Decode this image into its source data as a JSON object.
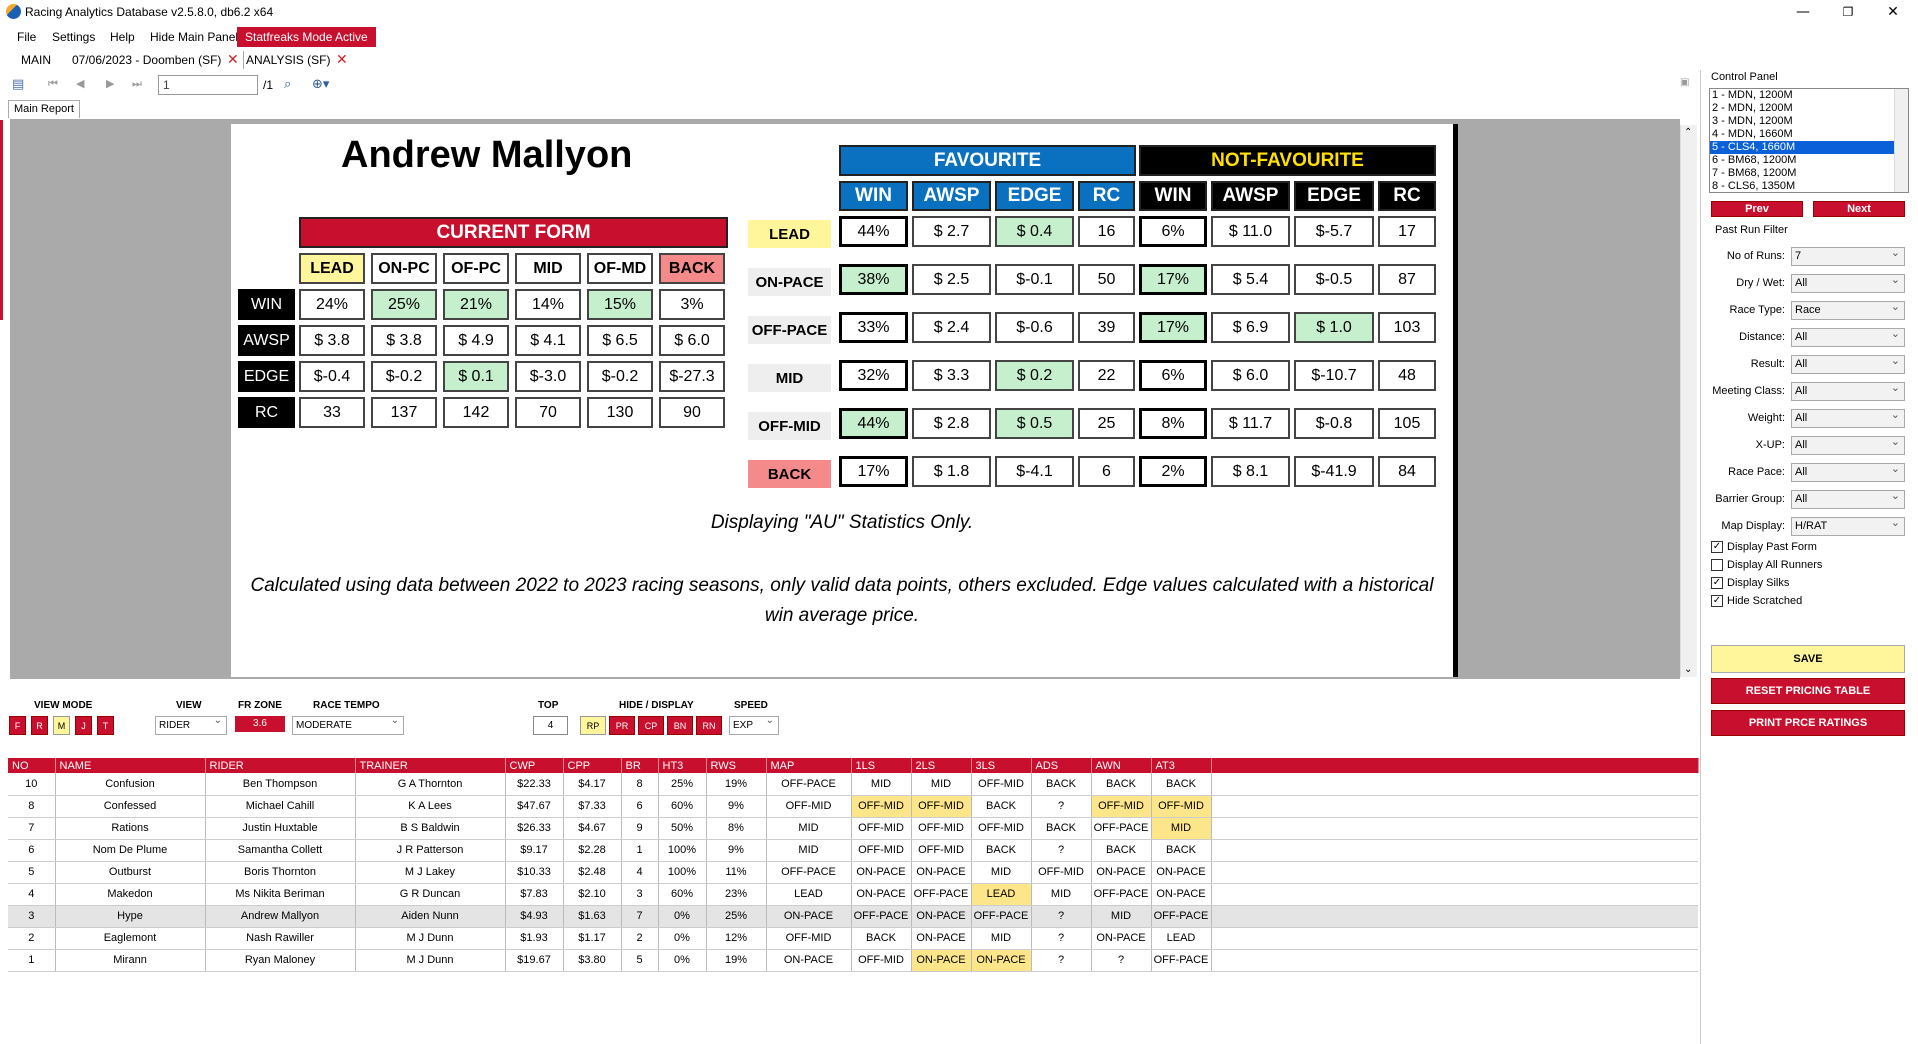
{
  "app": {
    "title": "Racing Analytics Database v2.5.8.0, db6.2 x64"
  },
  "window": {
    "minimize": "—",
    "restore": "❐",
    "close": "✕"
  },
  "menu": [
    "File",
    "Settings",
    "Help",
    "Hide Main Panel",
    "Statfreaks Mode Active"
  ],
  "doc_tabs": [
    "MAIN",
    "07/06/2023 - Doomben (SF)",
    "ANALYSIS (SF)"
  ],
  "toolbar": {
    "page_value": "1",
    "page_total": "/1"
  },
  "report_tab": "Main Report",
  "report": {
    "jockey": "Andrew Mallyon",
    "current_form": {
      "title": "CURRENT FORM",
      "columns": [
        "LEAD",
        "ON-PC",
        "OF-PC",
        "MID",
        "OF-MD",
        "BACK"
      ],
      "rows": [
        {
          "label": "WIN",
          "values": [
            "24%",
            "25%",
            "21%",
            "14%",
            "15%",
            "3%"
          ]
        },
        {
          "label": "AWSP",
          "values": [
            "$ 3.8",
            "$ 3.8",
            "$ 4.9",
            "$ 4.1",
            "$ 6.5",
            "$ 6.0"
          ]
        },
        {
          "label": "EDGE",
          "values": [
            "$-0.4",
            "$-0.2",
            "$ 0.1",
            "$-3.0",
            "$-0.2",
            "$-27.3"
          ]
        },
        {
          "label": "RC",
          "values": [
            "33",
            "137",
            "142",
            "70",
            "130",
            "90"
          ]
        }
      ]
    },
    "favourite": {
      "title": "FAVOURITE",
      "columns": [
        "WIN",
        "AWSP",
        "EDGE",
        "RC"
      ]
    },
    "not_favourite": {
      "title": "NOT-FAVOURITE",
      "columns": [
        "WIN",
        "AWSP",
        "EDGE",
        "RC"
      ]
    },
    "pace_rows": [
      {
        "label": "LEAD",
        "fav": [
          "44%",
          "$ 2.7",
          "$ 0.4",
          "16"
        ],
        "nfav": [
          "6%",
          "$ 11.0",
          "$-5.7",
          "17"
        ]
      },
      {
        "label": "ON-PACE",
        "fav": [
          "38%",
          "$ 2.5",
          "$-0.1",
          "50"
        ],
        "nfav": [
          "17%",
          "$ 5.4",
          "$-0.5",
          "87"
        ]
      },
      {
        "label": "OFF-PACE",
        "fav": [
          "33%",
          "$ 2.4",
          "$-0.6",
          "39"
        ],
        "nfav": [
          "17%",
          "$ 6.9",
          "$ 1.0",
          "103"
        ]
      },
      {
        "label": "MID",
        "fav": [
          "32%",
          "$ 3.3",
          "$ 0.2",
          "22"
        ],
        "nfav": [
          "6%",
          "$ 6.0",
          "$-10.7",
          "48"
        ]
      },
      {
        "label": "OFF-MID",
        "fav": [
          "44%",
          "$ 2.8",
          "$ 0.5",
          "25"
        ],
        "nfav": [
          "8%",
          "$ 11.7",
          "$-0.8",
          "105"
        ]
      },
      {
        "label": "BACK",
        "fav": [
          "17%",
          "$ 1.8",
          "$-4.1",
          "6"
        ],
        "nfav": [
          "2%",
          "$ 8.1",
          "$-41.9",
          "84"
        ]
      }
    ],
    "au_note": "Displaying \"AU\" Statistics Only.",
    "calc_note": "Calculated using data between 2022 to 2023 racing seasons, only valid data points, others excluded. Edge values calculated with a historical win average price."
  },
  "control_panel": {
    "title": "Control Panel",
    "races": [
      "1 - MDN, 1200M",
      "2 - MDN, 1200M",
      "3 - MDN, 1200M",
      "4 - MDN, 1660M",
      "5 - CLS4, 1660M",
      "6 - BM68, 1200M",
      "7 - BM68, 1200M",
      "8 - CLS6, 1350M"
    ],
    "prev": "Prev",
    "next": "Next",
    "filter_title": "Past Run Filter",
    "filters": [
      {
        "label": "No of Runs:",
        "value": "7"
      },
      {
        "label": "Dry / Wet:",
        "value": "All"
      },
      {
        "label": "Race Type:",
        "value": "Race"
      },
      {
        "label": "Distance:",
        "value": "All"
      },
      {
        "label": "Result:",
        "value": "All"
      },
      {
        "label": "Meeting Class:",
        "value": "All"
      },
      {
        "label": "Weight:",
        "value": "All"
      },
      {
        "label": "X-UP:",
        "value": "All"
      },
      {
        "label": "Race Pace:",
        "value": "All"
      },
      {
        "label": "Barrier Group:",
        "value": "All"
      },
      {
        "label": "Map Display:",
        "value": "H/RAT"
      }
    ],
    "checks": [
      {
        "label": "Display Past Form",
        "checked": "✓"
      },
      {
        "label": "Display All Runners",
        "checked": ""
      },
      {
        "label": "Display Silks",
        "checked": "✓"
      },
      {
        "label": "Hide Scratched",
        "checked": "✓"
      }
    ],
    "save": "SAVE",
    "reset": "RESET PRICING TABLE",
    "print": "PRINT PRCE RATINGS"
  },
  "bottom": {
    "view_mode_label": "VIEW MODE",
    "view_modes": [
      "F",
      "R",
      "M",
      "J",
      "T"
    ],
    "view_label": "VIEW",
    "view_value": "RIDER",
    "fr_zone_label": "FR ZONE",
    "fr_zone_value": "3.6",
    "tempo_label": "RACE TEMPO",
    "tempo_value": "MODERATE",
    "top_label": "TOP",
    "top_value": "4",
    "hide_label": "HIDE / DISPLAY",
    "hide_buttons": [
      "RP",
      "PR",
      "CP",
      "BN",
      "RN"
    ],
    "speed_label": "SPEED",
    "speed_value": "EXP"
  },
  "grid": {
    "columns": [
      "NO",
      "NAME",
      "RIDER",
      "TRAINER",
      "CWP",
      "CPP",
      "BR",
      "HT3",
      "RWS",
      "MAP",
      "1LS",
      "2LS",
      "3LS",
      "ADS",
      "AWN",
      "AT3"
    ],
    "rows": [
      [
        "10",
        "Confusion",
        "Ben Thompson",
        "G A Thornton",
        "$22.33",
        "$4.17",
        "8",
        "25%",
        "19%",
        "OFF-PACE",
        "MID",
        "MID",
        "OFF-MID",
        "BACK",
        "BACK",
        "BACK"
      ],
      [
        "8",
        "Confessed",
        "Michael Cahill",
        "K A Lees",
        "$47.67",
        "$7.33",
        "6",
        "60%",
        "9%",
        "OFF-MID",
        "OFF-MID",
        "OFF-MID",
        "BACK",
        "?",
        "OFF-MID",
        "OFF-MID"
      ],
      [
        "7",
        "Rations",
        "Justin Huxtable",
        "B S Baldwin",
        "$26.33",
        "$4.67",
        "9",
        "50%",
        "8%",
        "MID",
        "OFF-MID",
        "OFF-MID",
        "OFF-MID",
        "BACK",
        "OFF-PACE",
        "MID"
      ],
      [
        "6",
        "Nom De Plume",
        "Samantha Collett",
        "J R Patterson",
        "$9.17",
        "$2.28",
        "1",
        "100%",
        "9%",
        "MID",
        "OFF-MID",
        "OFF-MID",
        "BACK",
        "?",
        "BACK",
        "BACK"
      ],
      [
        "5",
        "Outburst",
        "Boris Thornton",
        "M J Lakey",
        "$10.33",
        "$2.48",
        "4",
        "100%",
        "11%",
        "OFF-PACE",
        "ON-PACE",
        "ON-PACE",
        "MID",
        "OFF-MID",
        "ON-PACE",
        "ON-PACE"
      ],
      [
        "4",
        "Makedon",
        "Ms Nikita Beriman",
        "G R Duncan",
        "$7.83",
        "$2.10",
        "3",
        "60%",
        "23%",
        "LEAD",
        "ON-PACE",
        "OFF-PACE",
        "LEAD",
        "MID",
        "OFF-PACE",
        "ON-PACE"
      ],
      [
        "3",
        "Hype",
        "Andrew Mallyon",
        "Aiden Nunn",
        "$4.93",
        "$1.63",
        "7",
        "0%",
        "25%",
        "ON-PACE",
        "OFF-PACE",
        "ON-PACE",
        "OFF-PACE",
        "?",
        "MID",
        "OFF-PACE"
      ],
      [
        "2",
        "Eaglemont",
        "Nash Rawiller",
        "M J Dunn",
        "$1.93",
        "$1.17",
        "2",
        "0%",
        "12%",
        "OFF-MID",
        "BACK",
        "ON-PACE",
        "MID",
        "?",
        "ON-PACE",
        "LEAD"
      ],
      [
        "1",
        "Mirann",
        "Ryan Maloney",
        "M J Dunn",
        "$19.67",
        "$3.80",
        "5",
        "0%",
        "19%",
        "ON-PACE",
        "OFF-MID",
        "ON-PACE",
        "ON-PACE",
        "?",
        "?",
        "OFF-PACE"
      ]
    ]
  }
}
